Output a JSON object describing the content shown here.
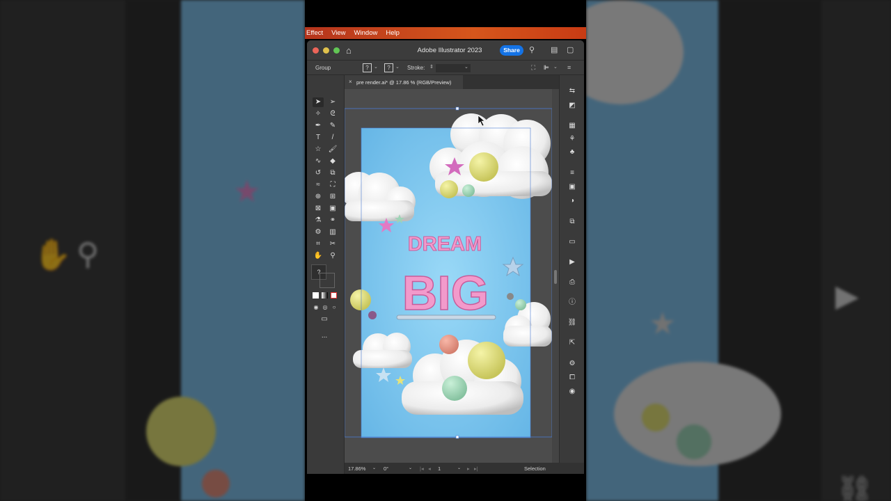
{
  "menubar": {
    "items": [
      "Effect",
      "View",
      "Window",
      "Help"
    ]
  },
  "window": {
    "title": "Adobe Illustrator 2023",
    "share_label": "Share"
  },
  "control_bar": {
    "selection_label": "Group",
    "fill_placeholder": "?",
    "stroke_placeholder": "?",
    "stroke_label": "Stroke:"
  },
  "document_tab": {
    "name": "pre render.ai* @ 17.86 % (RGB/Preview)",
    "close": "×"
  },
  "artwork": {
    "headline_small": "DREAM",
    "headline_big": "BIG",
    "colors": {
      "sky": "#86cdf2",
      "cloud": "#f1f1f1",
      "text_pink": "#f29acb",
      "ball_yellow": "#e7e585",
      "ball_green": "#a8dcbf",
      "ball_salmon": "#e89a8a"
    }
  },
  "status_bar": {
    "zoom": "17.86%",
    "rotation": "0°",
    "artboard": "1",
    "tool": "Selection"
  },
  "tools": {
    "left_column": [
      "selection-tool",
      "magic-wand-tool",
      "pen-tool",
      "type-tool",
      "star-tool",
      "shaper-tool",
      "rotate-tool",
      "warp-tool",
      "shape-builder-tool",
      "mesh-tool",
      "eyedropper-tool",
      "symbol-sprayer-tool",
      "artboard-tool",
      "hand-tool"
    ],
    "right_column": [
      "direct-selection-tool",
      "lasso-tool",
      "curvature-tool",
      "line-tool",
      "paintbrush-tool",
      "eraser-tool",
      "scale-tool",
      "free-transform-tool",
      "perspective-grid-tool",
      "gradient-tool",
      "blend-tool",
      "column-graph-tool",
      "slice-tool",
      "zoom-tool"
    ],
    "unknown_label": "?"
  },
  "more_tools_label": "..."
}
